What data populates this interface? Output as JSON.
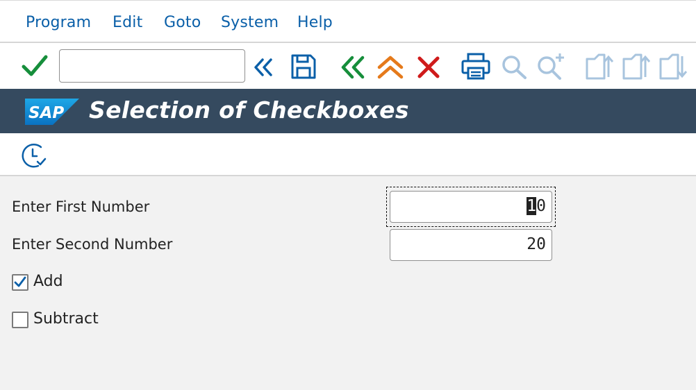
{
  "menu": {
    "items": [
      "Program",
      "Edit",
      "Goto",
      "System",
      "Help"
    ]
  },
  "toolbar": {
    "command_field_value": "",
    "icons": [
      "enter-check-icon",
      "collapse-icon",
      "save-icon",
      "back-icon",
      "exit-icon",
      "cancel-icon",
      "print-icon",
      "find-icon",
      "find-next-icon",
      "first-page-icon",
      "previous-page-icon",
      "next-page-icon"
    ]
  },
  "titlebar": {
    "logo_text": "SAP",
    "title": "Selection of Checkboxes",
    "bg_color": "#354a5f"
  },
  "app_toolbar": {
    "icons": [
      "execute-icon"
    ]
  },
  "form": {
    "first_label": "Enter First Number",
    "first_value_selected": "1",
    "first_value_rest": "0",
    "second_label": "Enter Second Number",
    "second_value": "20",
    "checkboxes": [
      {
        "label": "Add",
        "checked": true
      },
      {
        "label": "Subtract",
        "checked": false
      }
    ]
  }
}
